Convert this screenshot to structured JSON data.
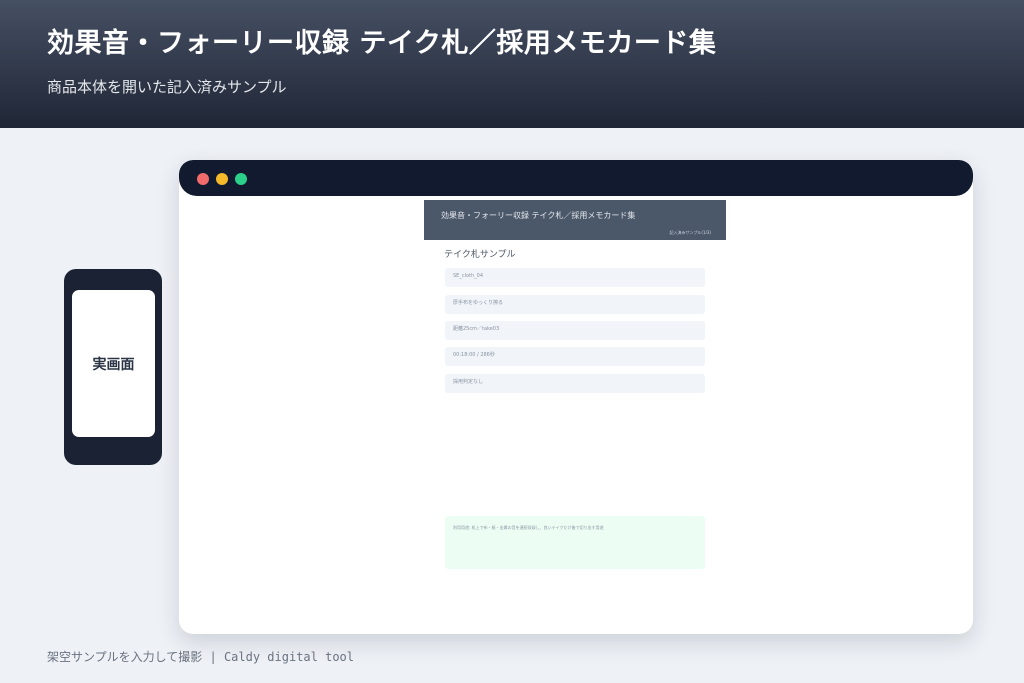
{
  "hero": {
    "title": "効果音・フォーリー収録 テイク札／採用メモカード集",
    "subtitle": "商品本体を開いた記入済みサンプル"
  },
  "app": {
    "header_title": "効果音・フォーリー収録 テイク札／採用メモカード集",
    "header_note": "記入済みサンプル(1/3)",
    "section_title": "テイク札サンプル",
    "fields": [
      "SE_cloth_04",
      "厚手布をゆっくり擦る",
      "距離25cm／take03",
      "00:18:00 / 286秒",
      "採用判定なし"
    ],
    "note": "利用用途: 机上で布・紙・金属の音を連続収録し、良いテイクだけ後で切り出す用途"
  },
  "phone": {
    "label": "実画面"
  },
  "footer": {
    "text": "架空サンプルを入力して撮影 | Caldy digital tool"
  },
  "colors": {
    "hero_top": "#465063",
    "hero_bottom": "#1f2636",
    "browser_bar": "#111a2e",
    "app_header": "#4b586a",
    "dot_red": "#f26b6b",
    "dot_yellow": "#f5b92a",
    "dot_green": "#2bd08a",
    "note_bg": "#ecfdf3"
  }
}
